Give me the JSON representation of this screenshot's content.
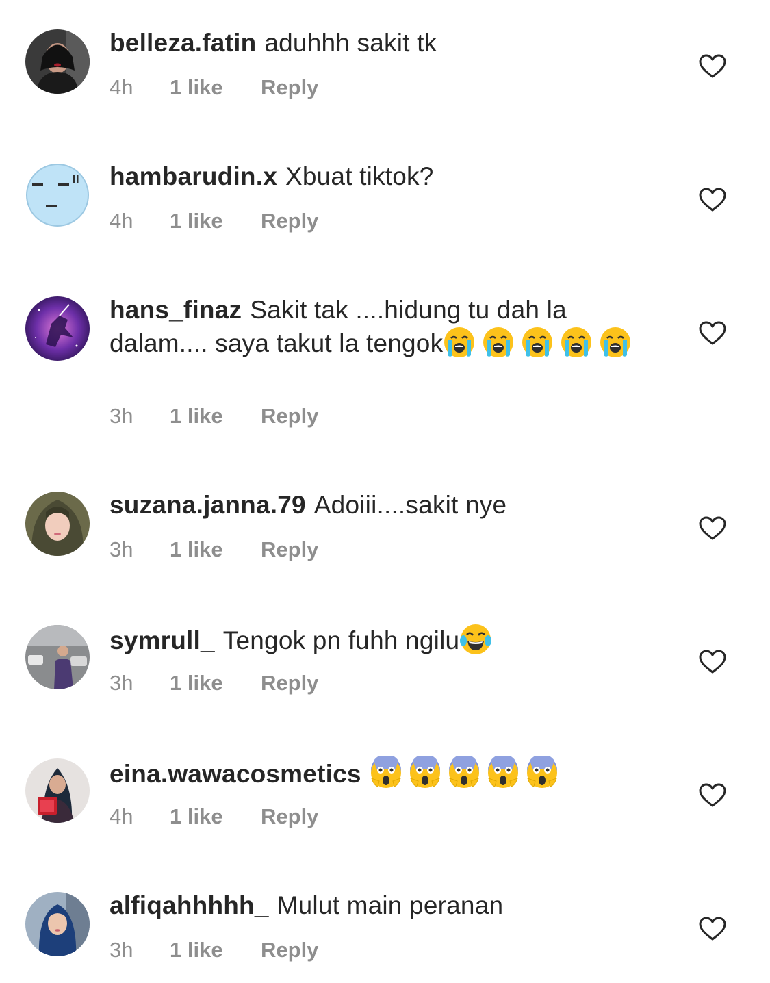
{
  "comments": [
    {
      "username": "belleza.fatin",
      "text": "aduhhh sakit tk",
      "time": "4h",
      "likes": "1 like",
      "reply": "Reply"
    },
    {
      "username": "hambarudin.x",
      "text": "Xbuat tiktok?",
      "time": "4h",
      "likes": "1 like",
      "reply": "Reply"
    },
    {
      "username": "hans_finaz",
      "text": "Sakit tak ....hidung tu dah la dalam.... saya takut la tengok",
      "time": "3h",
      "likes": "1 like",
      "reply": "Reply"
    },
    {
      "username": "suzana.janna.79",
      "text": "Adoiii....sakit nye",
      "time": "3h",
      "likes": "1 like",
      "reply": "Reply"
    },
    {
      "username": "symrull_",
      "text": "Tengok pn fuhh ngilu",
      "time": "3h",
      "likes": "1 like",
      "reply": "Reply"
    },
    {
      "username": "eina.wawacosmetics",
      "text": "",
      "time": "4h",
      "likes": "1 like",
      "reply": "Reply"
    },
    {
      "username": "alfiqahhhhh_",
      "text": "Mulut main peranan",
      "time": "3h",
      "likes": "1 like",
      "reply": "Reply"
    }
  ],
  "icons": {
    "heart": "heart-outline-icon",
    "emoji_crying": "loudly-crying-face",
    "emoji_tears_of_joy": "face-with-tears-of-joy",
    "emoji_screaming": "face-screaming-in-fear"
  },
  "colors": {
    "text": "#262626",
    "meta": "#8e8e8e",
    "background": "#ffffff"
  }
}
